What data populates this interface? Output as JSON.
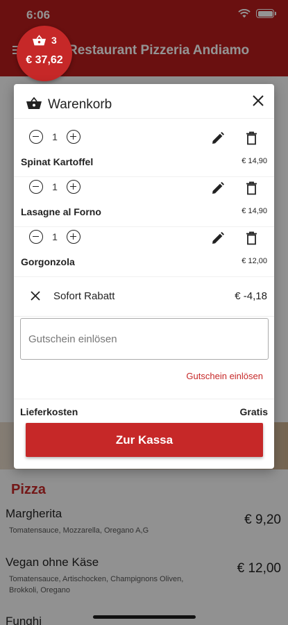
{
  "status_bar": {
    "time": "6:06"
  },
  "app": {
    "title": "Restaurant Pizzeria Andiamo"
  },
  "cart_badge": {
    "count": "3",
    "total": "€ 37,62"
  },
  "background": {
    "section_title": "Pizza",
    "items": [
      {
        "name": "Margherita",
        "desc": "Tomatensauce, Mozzarella, Oregano A,G",
        "price": "€ 9,20"
      },
      {
        "name": "Vegan ohne Käse",
        "desc": "Tomatensauce, Artischocken, Champignons Oliven, Brokkoli, Oregano",
        "price": "€ 12,00"
      },
      {
        "name": "Funghi",
        "desc": "",
        "price": ""
      }
    ]
  },
  "cart": {
    "title": "Warenkorb",
    "items": [
      {
        "qty": "1",
        "name": "Spinat Kartoffel",
        "price": "€ 14,90"
      },
      {
        "qty": "1",
        "name": "Lasagne al Forno",
        "price": "€ 14,90"
      },
      {
        "qty": "1",
        "name": "Gorgonzola",
        "price": "€ 12,00"
      }
    ],
    "discount": {
      "label": "Sofort Rabatt",
      "value": "€ -4,18"
    },
    "voucher": {
      "placeholder": "Gutschein einlösen",
      "link": "Gutschein einlösen"
    },
    "delivery": {
      "label": "Lieferkosten",
      "value": "Gratis"
    },
    "checkout_label": "Zur Kassa"
  },
  "colors": {
    "brand_red": "#c62828",
    "appbar_red": "#b71c1c"
  },
  "icons": [
    "basket-icon",
    "close-icon",
    "minus-icon",
    "plus-icon",
    "edit-icon",
    "trash-icon",
    "menu-icon",
    "wifi-icon",
    "battery-icon"
  ]
}
